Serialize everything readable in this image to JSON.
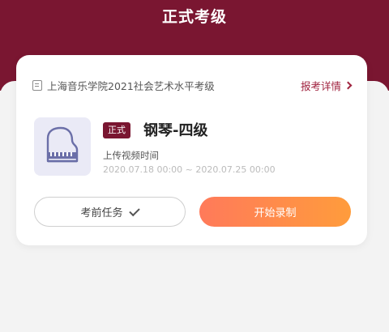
{
  "header": {
    "title": "正式考级",
    "band_color": "#7a1631"
  },
  "card": {
    "exam_icon": "document-icon",
    "exam_name": "上海音乐学院2021社会艺术水平考级",
    "detail_link": "报考详情",
    "detail_chevron": "chevron-right-icon",
    "thumbnail_icon": "piano-icon",
    "level_tag": "正式",
    "subject": "钢琴-四级",
    "upload_label": "上传视频时间",
    "upload_range": "2020.07.18 00:00 ~ 2020.07.25 00:00",
    "task_button": "考前任务",
    "task_check_icon": "check-icon",
    "start_button": "开始录制",
    "accent_color": "#a0233f",
    "button_gradient": [
      "#ff7a5a",
      "#ff9c3c"
    ]
  }
}
